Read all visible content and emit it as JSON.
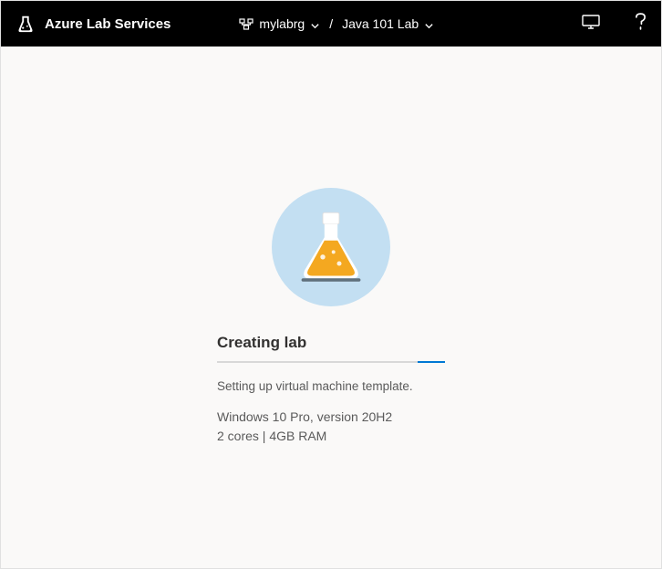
{
  "header": {
    "product_name": "Azure Lab Services",
    "resource_group": "mylabrg",
    "lab_name": "Java 101 Lab"
  },
  "status": {
    "title": "Creating lab",
    "subtitle": "Setting up virtual machine template.",
    "os_info": "Windows 10 Pro, version 20H2",
    "hardware_info": "2 cores | 4GB RAM"
  }
}
